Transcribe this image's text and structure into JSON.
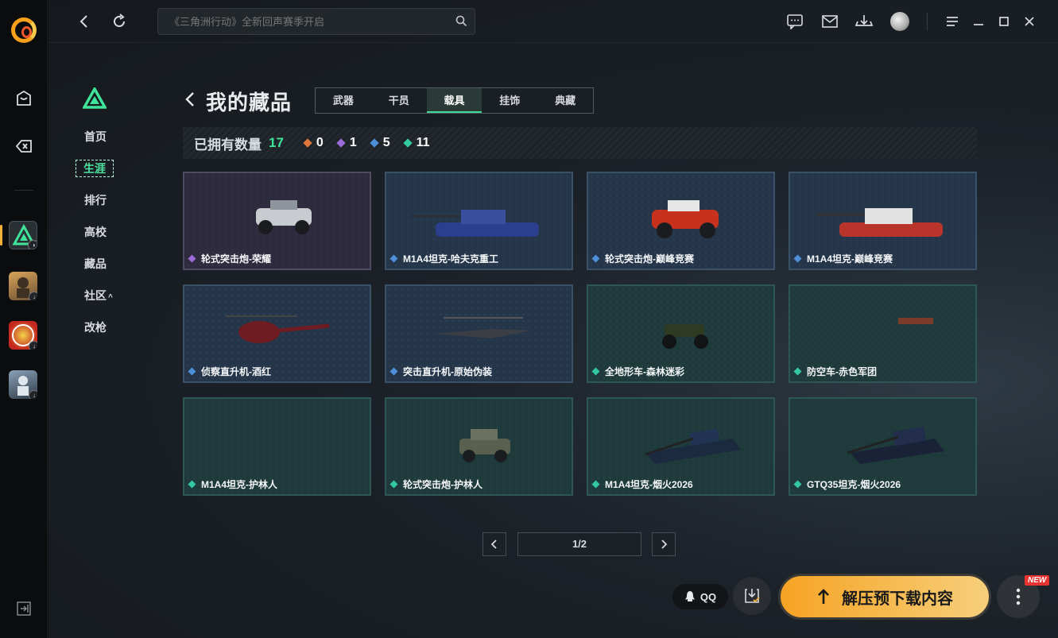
{
  "topbar": {
    "search_placeholder": "《三角洲行动》全新回声赛季开启"
  },
  "subnav": {
    "items": [
      {
        "label": "首页"
      },
      {
        "label": "生涯"
      },
      {
        "label": "排行"
      },
      {
        "label": "高校"
      },
      {
        "label": "藏品"
      },
      {
        "label": "社区"
      },
      {
        "label": "改枪"
      }
    ],
    "community_caret": "^"
  },
  "page": {
    "title": "我的藏品",
    "tabs": [
      {
        "label": "武器"
      },
      {
        "label": "干员"
      },
      {
        "label": "载具"
      },
      {
        "label": "挂饰"
      },
      {
        "label": "典藏"
      }
    ],
    "active_tab": "载具"
  },
  "counts": {
    "label": "已拥有数量",
    "total": "17",
    "by_rarity": [
      {
        "rarity": "gold",
        "color": "#e0773a",
        "value": "0"
      },
      {
        "rarity": "purple",
        "color": "#9b6bd9",
        "value": "1"
      },
      {
        "rarity": "blue",
        "color": "#4d8fd9",
        "value": "5"
      },
      {
        "rarity": "green",
        "color": "#33c9a0",
        "value": "11"
      }
    ]
  },
  "cards": [
    {
      "name": "轮式突击炮-荣耀",
      "rarity": "purple",
      "vehicle": "car-icon"
    },
    {
      "name": "M1A4坦克-哈夫克重工",
      "rarity": "blue",
      "vehicle": "tank-icon"
    },
    {
      "name": "轮式突击炮-巅峰竞赛",
      "rarity": "blue",
      "vehicle": "car-icon"
    },
    {
      "name": "M1A4坦克-巅峰竞赛",
      "rarity": "blue",
      "vehicle": "tank-icon"
    },
    {
      "name": "侦察直升机-酒红",
      "rarity": "blue",
      "vehicle": "helicopter-icon"
    },
    {
      "name": "突击直升机-原始伪装",
      "rarity": "blue",
      "vehicle": "helicopter-icon"
    },
    {
      "name": "全地形车-森林迷彩",
      "rarity": "green",
      "vehicle": "atv-icon"
    },
    {
      "name": "防空车-赤色军团",
      "rarity": "green",
      "vehicle": "aa-vehicle-icon"
    },
    {
      "name": "M1A4坦克-护林人",
      "rarity": "green",
      "vehicle": "none"
    },
    {
      "name": "轮式突击炮-护林人",
      "rarity": "green",
      "vehicle": "car-icon"
    },
    {
      "name": "M1A4坦克-烟火2026",
      "rarity": "green",
      "vehicle": "tank-icon"
    },
    {
      "name": "GTQ35坦克-烟火2026",
      "rarity": "green",
      "vehicle": "tank-icon"
    }
  ],
  "pager": {
    "text": "1/2",
    "current": 1,
    "total": 2
  },
  "actions": {
    "qq_label": "QQ",
    "primary_label": "解压预下载内容",
    "new_badge": "NEW"
  },
  "colors": {
    "accent_green": "#3fe39a",
    "primary_button": "#f6a323"
  }
}
